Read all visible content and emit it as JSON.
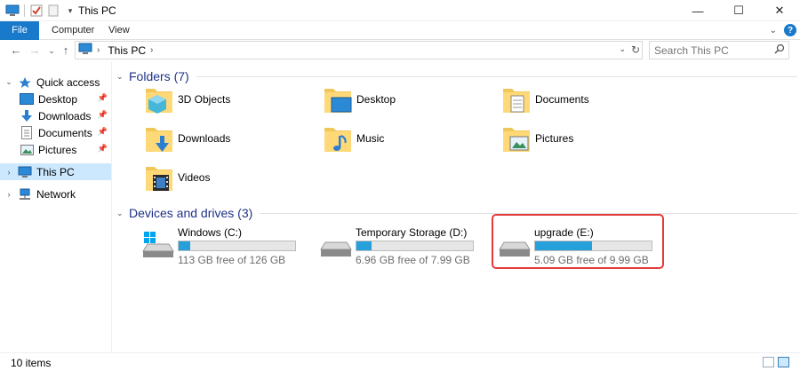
{
  "window": {
    "title": "This PC"
  },
  "ribbon": {
    "tabs": [
      "File",
      "Computer",
      "View"
    ]
  },
  "address": {
    "crumb": "This PC",
    "search_placeholder": "Search This PC"
  },
  "nav": {
    "quick_access": "Quick access",
    "quick_items": [
      "Desktop",
      "Downloads",
      "Documents",
      "Pictures"
    ],
    "this_pc": "This PC",
    "network": "Network"
  },
  "folders": {
    "header": "Folders (7)",
    "items": [
      "3D Objects",
      "Desktop",
      "Documents",
      "Downloads",
      "Music",
      "Pictures",
      "Videos"
    ]
  },
  "drives": {
    "header": "Devices and drives (3)",
    "items": [
      {
        "name": "Windows (C:)",
        "free": "113 GB free of 126 GB",
        "used_fraction": 0.1
      },
      {
        "name": "Temporary Storage (D:)",
        "free": "6.96 GB free of 7.99 GB",
        "used_fraction": 0.13
      },
      {
        "name": "upgrade (E:)",
        "free": "5.09 GB free of 9.99 GB",
        "used_fraction": 0.49
      }
    ]
  },
  "status": {
    "items": "10 items"
  },
  "colors": {
    "accent": "#1979ca",
    "drive_bar": "#26a0da",
    "highlight": "#e33a3a",
    "group_header": "#1e3287"
  }
}
